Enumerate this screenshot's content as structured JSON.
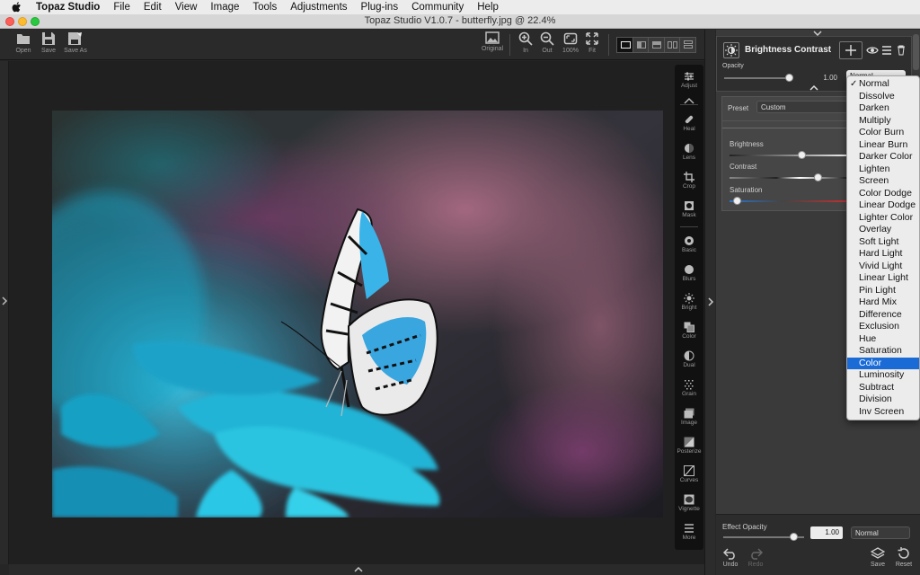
{
  "menubar": {
    "items": [
      "Topaz Studio",
      "File",
      "Edit",
      "View",
      "Image",
      "Tools",
      "Adjustments",
      "Plug-ins",
      "Community",
      "Help"
    ]
  },
  "window": {
    "title": "Topaz Studio V1.0.7 - butterfly.jpg @ 22.4%"
  },
  "toolbar": {
    "open": "Open",
    "save": "Save",
    "save_as": "Save As",
    "original": "Original",
    "zoom_in": "In",
    "zoom_out": "Out",
    "zoom_100": "100%",
    "fit": "Fit"
  },
  "tools": [
    {
      "label": "Adjust",
      "icon": "sliders-icon"
    },
    {
      "label": "Heal",
      "icon": "bandage-icon"
    },
    {
      "label": "Lens",
      "icon": "lens-icon"
    },
    {
      "label": "Crop",
      "icon": "crop-icon"
    },
    {
      "label": "Mask",
      "icon": "mask-icon"
    },
    {
      "label": "Basic",
      "icon": "aperture-icon"
    },
    {
      "label": "Blurs",
      "icon": "blur-icon"
    },
    {
      "label": "Bright",
      "icon": "sun-icon"
    },
    {
      "label": "Color",
      "icon": "color-icon"
    },
    {
      "label": "Dual",
      "icon": "dual-icon"
    },
    {
      "label": "Grain",
      "icon": "grain-icon"
    },
    {
      "label": "Image",
      "icon": "image-icon"
    },
    {
      "label": "Posterize",
      "icon": "posterize-icon"
    },
    {
      "label": "Curves",
      "icon": "curves-icon"
    },
    {
      "label": "Vignette",
      "icon": "vignette-icon"
    },
    {
      "label": "More",
      "icon": "more-icon"
    }
  ],
  "filter": {
    "title": "Brightness Contrast",
    "opacity_label": "Opacity",
    "opacity_value": "1.00",
    "blend_value": "Normal",
    "preset_label": "Preset",
    "preset_value": "Custom",
    "brightness_label": "Brightness",
    "contrast_label": "Contrast",
    "saturation_label": "Saturation"
  },
  "effect": {
    "opacity_label": "Effect Opacity",
    "opacity_value": "1.00",
    "blend_value": "Normal"
  },
  "bottom_buttons": {
    "undo": "Undo",
    "redo": "Redo",
    "save": "Save",
    "reset": "Reset"
  },
  "blend_modes": {
    "items": [
      "Normal",
      "Dissolve",
      "Darken",
      "Multiply",
      "Color Burn",
      "Linear Burn",
      "Darker Color",
      "Lighten",
      "Screen",
      "Color Dodge",
      "Linear Dodge",
      "Lighter Color",
      "Overlay",
      "Soft Light",
      "Hard Light",
      "Vivid Light",
      "Linear Light",
      "Pin Light",
      "Hard Mix",
      "Difference",
      "Exclusion",
      "Hue",
      "Saturation",
      "Color",
      "Luminosity",
      "Subtract",
      "Division",
      "Inv Screen"
    ],
    "checked": "Normal",
    "highlighted": "Color"
  },
  "colors": {
    "accent": "#1a6bd6",
    "panel": "#3a3a3a",
    "canvas": "#202020"
  }
}
